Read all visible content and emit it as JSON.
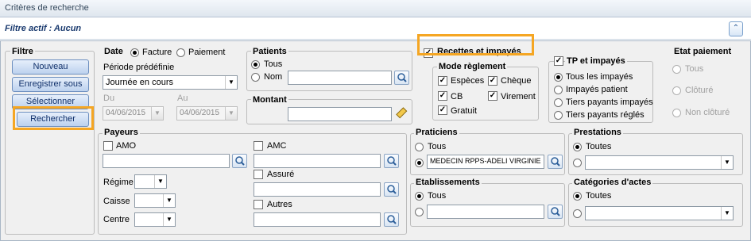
{
  "window": {
    "title": "Critères de recherche"
  },
  "filter_bar": {
    "label": "Filtre actif :  Aucun",
    "collapse_icon": "double-chevron-up-icon"
  },
  "filtre": {
    "legend": "Filtre",
    "buttons": [
      "Nouveau",
      "Enregistrer sous",
      "Sélectionner",
      "Rechercher"
    ]
  },
  "date": {
    "legend": "Date",
    "facture": "Facture",
    "paiement": "Paiement",
    "selected": "Facture",
    "periode_label": "Période prédéfinie",
    "periode_value": "Journée en cours",
    "du_label": "Du",
    "du_value": "04/06/2015",
    "au_label": "Au",
    "au_value": "04/06/2015"
  },
  "patients": {
    "legend": "Patients",
    "tous": "Tous",
    "nom": "Nom",
    "selected": "Tous",
    "nom_value": ""
  },
  "montant": {
    "legend": "Montant",
    "value": ""
  },
  "recettes": {
    "label": "Recettes et impayés",
    "checked": true
  },
  "mode_reglement": {
    "legend": "Mode règlement",
    "items": [
      {
        "label": "Espèces",
        "checked": true
      },
      {
        "label": "Chèque",
        "checked": true
      },
      {
        "label": "CB",
        "checked": true
      },
      {
        "label": "Virement",
        "checked": true
      },
      {
        "label": "Gratuit",
        "checked": true
      }
    ]
  },
  "tp": {
    "legend": "TP et impayés",
    "checked": true,
    "options": [
      "Tous les impayés",
      "Impayés patient",
      "Tiers payants impayés",
      "Tiers payants réglés"
    ],
    "selected": "Tous les impayés"
  },
  "etat_paiement": {
    "legend": "Etat paiement",
    "options": [
      "Tous",
      "Clôturé",
      "Non clôturé"
    ]
  },
  "payeurs": {
    "legend": "Payeurs",
    "amo": "AMO",
    "amc": "AMC",
    "assure": "Assuré",
    "autres": "Autres",
    "regime": "Régime",
    "caisse": "Caisse",
    "centre": "Centre"
  },
  "praticiens": {
    "legend": "Praticiens",
    "tous": "Tous",
    "value": "MEDECIN RPPS-ADELI VIRGINIE",
    "selected": "specific"
  },
  "prestations": {
    "legend": "Prestations",
    "toutes": "Toutes",
    "selected": "Toutes"
  },
  "etablissements": {
    "legend": "Etablissements",
    "tous": "Tous",
    "selected": "Tous"
  },
  "categories": {
    "legend": "Catégories d'actes",
    "toutes": "Toutes",
    "selected": "Toutes"
  },
  "highlight_color": "#f5a623"
}
